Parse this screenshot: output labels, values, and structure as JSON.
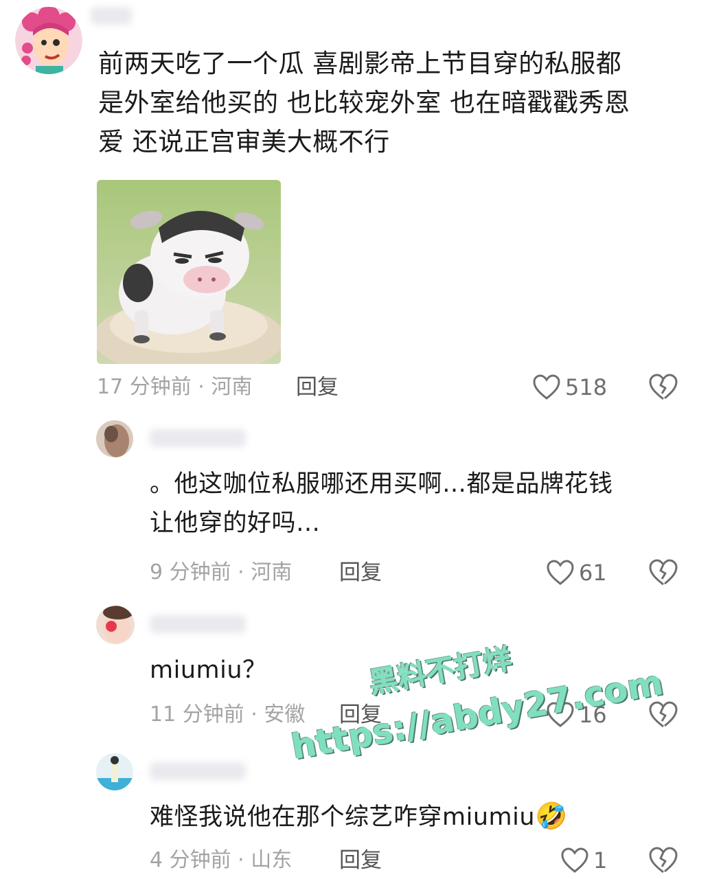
{
  "comments": [
    {
      "text_lines": [
        "前两天吃了一个瓜 喜剧影帝上节目穿的私服都",
        "是外室给他买的 也比较宠外室 也在暗戳戳秀恩",
        "爱 还说正宫审美大概不行"
      ],
      "meta": "17 分钟前 · 河南",
      "reply": "回复",
      "likes": "518"
    },
    {
      "text_lines": [
        "。他这咖位私服哪还用买啊…都是品牌花钱",
        "让他穿的好吗…"
      ],
      "meta": "9 分钟前 · 河南",
      "reply": "回复",
      "likes": "61"
    },
    {
      "text_lines": [
        "miumiu？"
      ],
      "meta": "11 分钟前 · 安徽",
      "reply": "回复",
      "likes": "16"
    },
    {
      "text_lines": [
        "难怪我说他在那个综艺咋穿miumiu"
      ],
      "emoji": "🤣",
      "meta": "4 分钟前 · 山东",
      "reply": "回复",
      "likes": "1"
    }
  ],
  "watermark": {
    "line1": "黑料不打烊",
    "line2": "https://abdy27.com"
  },
  "colors": {
    "meta": "#a3a3a3",
    "icon": "#6e6e6e",
    "watermark": "#7fe0c0"
  },
  "icons": [
    "heart-icon",
    "broken-heart-icon"
  ]
}
